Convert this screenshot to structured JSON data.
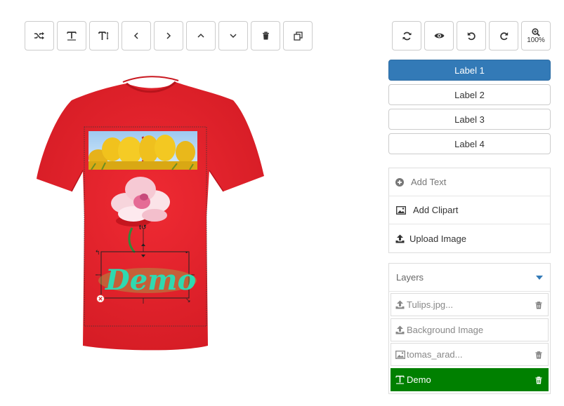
{
  "toolbar": {
    "left_buttons": [
      {
        "name": "shuffle-button",
        "icon": "shuffle-icon"
      },
      {
        "name": "text-button",
        "icon": "text-icon"
      },
      {
        "name": "text-size-button",
        "icon": "text-size-icon"
      },
      {
        "name": "prev-button",
        "icon": "chevron-left-icon"
      },
      {
        "name": "next-button",
        "icon": "chevron-right-icon"
      },
      {
        "name": "move-up-button",
        "icon": "chevron-up-icon"
      },
      {
        "name": "move-down-button",
        "icon": "chevron-down-icon"
      },
      {
        "name": "delete-button",
        "icon": "trash-icon"
      },
      {
        "name": "clone-button",
        "icon": "clone-icon"
      }
    ],
    "right_buttons": [
      {
        "name": "refresh-button",
        "icon": "refresh-icon"
      },
      {
        "name": "preview-button",
        "icon": "eye-icon"
      },
      {
        "name": "undo-button",
        "icon": "undo-icon"
      },
      {
        "name": "redo-button",
        "icon": "redo-icon"
      }
    ],
    "zoom_label": "100%"
  },
  "labels": [
    {
      "text": "Label 1",
      "active": true
    },
    {
      "text": "Label 2",
      "active": false
    },
    {
      "text": "Label 3",
      "active": false
    },
    {
      "text": "Label 4",
      "active": false
    }
  ],
  "actions": {
    "add_text": "Add Text",
    "add_clipart": "Add Clipart",
    "upload_image": "Upload Image"
  },
  "layers": {
    "title": "Layers",
    "items": [
      {
        "label": "Tulips.jpg...",
        "icon": "upload-icon",
        "deletable": true,
        "selected": false
      },
      {
        "label": "Background Image",
        "icon": "upload-icon",
        "deletable": false,
        "selected": false
      },
      {
        "label": "tomas_arad...",
        "icon": "image-icon",
        "deletable": true,
        "selected": false
      },
      {
        "label": "Demo",
        "icon": "text-icon",
        "deletable": true,
        "selected": true
      }
    ]
  },
  "canvas": {
    "demo_text": "Demo",
    "shirt_color": "#e8202a",
    "demo_color": "#2fd9b0",
    "selection_color": "#222222",
    "delete_handle_color": "#e03030"
  }
}
